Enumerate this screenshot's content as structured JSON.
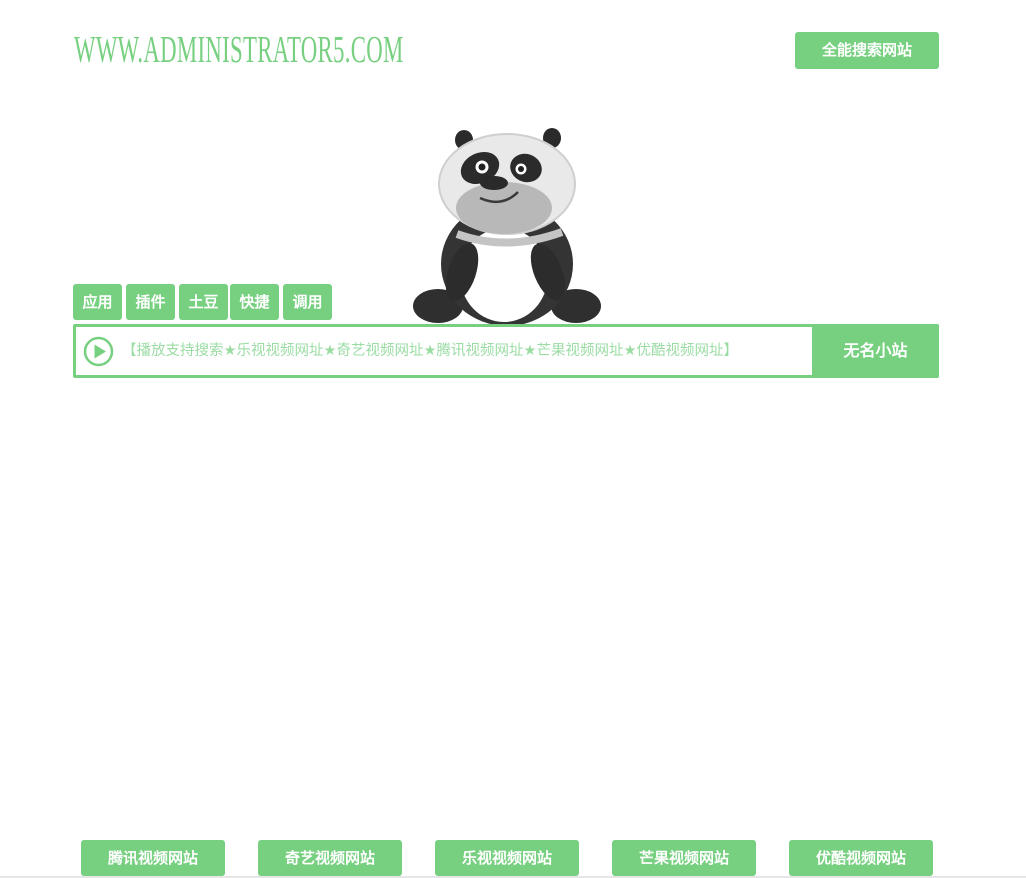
{
  "header": {
    "logo_text": "WWW.ADMINISTRATOR5.COM",
    "search_all_button": "全能搜索网站"
  },
  "mascot": {
    "icon": "panda-mascot"
  },
  "tabs": [
    {
      "label": "应用"
    },
    {
      "label": "插件"
    },
    {
      "label": "土豆"
    },
    {
      "label": "快捷"
    },
    {
      "label": "调用"
    }
  ],
  "search": {
    "icon": "play-circle-icon",
    "placeholder": "【播放支持搜索★乐视视频网址★奇艺视频网址★腾讯视频网址★芒果视频网址★优酷视频网址】",
    "value": "",
    "button_label": "无名小站"
  },
  "footer_links": [
    {
      "label": "腾讯视频网站"
    },
    {
      "label": "奇艺视频网站"
    },
    {
      "label": "乐视视频网站"
    },
    {
      "label": "芒果视频网站"
    },
    {
      "label": "优酷视频网站"
    }
  ],
  "colors": {
    "accent": "#77d080",
    "placeholder": "#9bdca4",
    "background": "#ffffff"
  }
}
